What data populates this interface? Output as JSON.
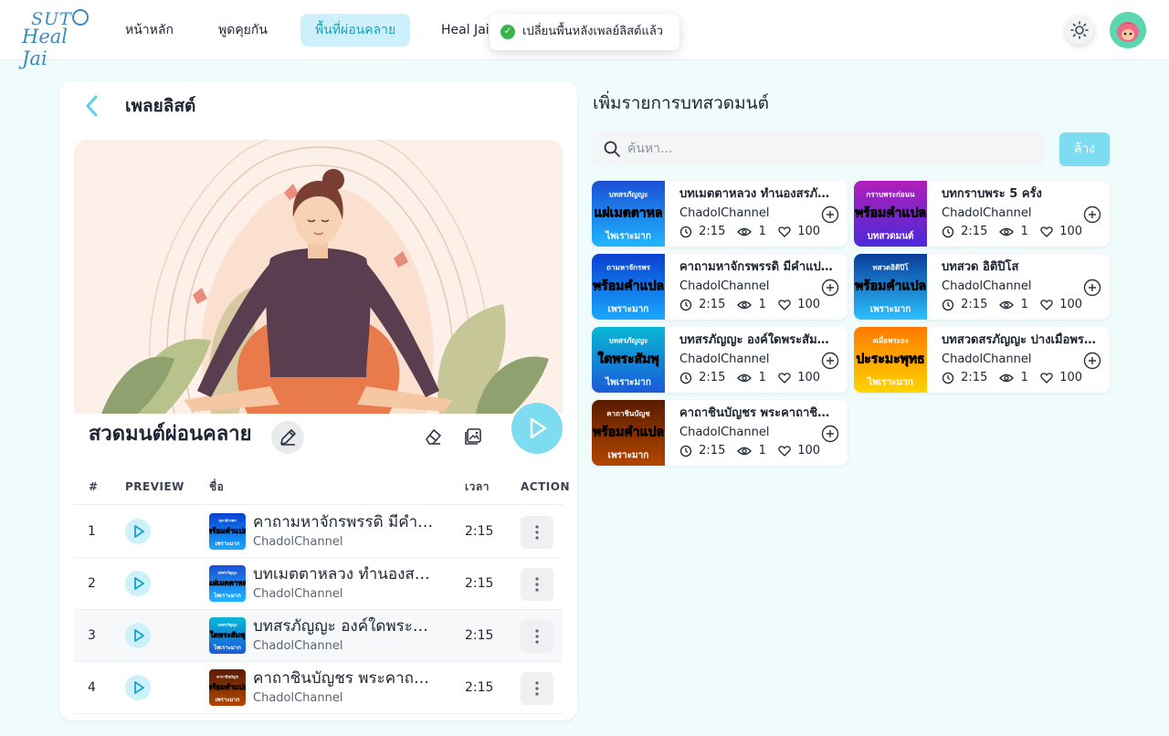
{
  "header": {
    "logo_line1": "SUT",
    "logo_line2": "Heal Jai",
    "nav": [
      {
        "label": "หน้าหลัก",
        "active": false
      },
      {
        "label": "พูดคุยกัน",
        "active": false
      },
      {
        "label": "พื้นที่ผ่อนคลาย",
        "active": true
      },
      {
        "label": "Heal Jai",
        "active": false
      }
    ],
    "toast": "เปลี่ยนพื้นหลังเพลย์ลิสต์แล้ว"
  },
  "playlist": {
    "title": "เพลยลิสต์",
    "name": "สวดมนต์ผ่อนคลาย",
    "table": {
      "headers": {
        "num": "#",
        "preview": "PREVIEW",
        "name": "ชื่อ",
        "time": "เวลา",
        "action": "ACTION"
      },
      "rows": [
        {
          "num": "1",
          "title": "คาถามหาจักรพรรดิ มีคำแปล...",
          "channel": "ChadolChannel",
          "duration": "2:15",
          "thumb_top": "มหาจักรพร",
          "thumb_mid": "(พร้อมคำแปล)",
          "thumb_bottom": "เพราะมาก"
        },
        {
          "num": "2",
          "title": "บทเมตตาหลวง ทำนองสรภัญญะ",
          "channel": "ChadolChannel",
          "duration": "2:15",
          "thumb_top": "บทสรภัญญะ",
          "thumb_mid": "แผ่เมตตาหล",
          "thumb_bottom": "ไพเราะมาก"
        },
        {
          "num": "3",
          "title": "บทสรภัญญะ องค์ใดพระสัมพุทธ",
          "channel": "ChadolChannel",
          "duration": "2:15",
          "thumb_top": "บทสรภัญญะ",
          "thumb_mid": "ใดพระสัมพุ",
          "thumb_bottom": "ไพเราะมาก"
        },
        {
          "num": "4",
          "title": "คาถาชินบัญชร พระคาถาชินบัญชร",
          "channel": "ChadolChannel",
          "duration": "2:15",
          "thumb_top": "คาถาชินบัญช",
          "thumb_mid": "(พร้อมคำแปล)",
          "thumb_bottom": "เพราะมาก"
        }
      ]
    }
  },
  "add_panel": {
    "title": "เพิ่มรายการบทสวดมนต์",
    "search_placeholder": "ค้นหา...",
    "clear_label": "ล้าง",
    "cards": [
      {
        "title": "บทเมตตาหลวง ทำนองสรภัญญะ",
        "channel": "ChadolChannel",
        "duration": "2:15",
        "views": "1",
        "likes": "100",
        "thumb_top": "บทสรภัญญะ",
        "thumb_mid": "แผ่เมตตาหล",
        "thumb_bottom": "ไพเราะมาก"
      },
      {
        "title": "บทกราบพระ 5 ครั้ง",
        "channel": "ChadolChannel",
        "duration": "2:15",
        "views": "1",
        "likes": "100",
        "thumb_top": "กราบพระก่อนน",
        "thumb_mid": "(พร้อมคำแปล)",
        "thumb_bottom": "บทสวดมนต์"
      },
      {
        "title": "คาถามหาจักรพรรดิ มีคำแปล...",
        "channel": "ChadolChannel",
        "duration": "2:15",
        "views": "1",
        "likes": "100",
        "thumb_top": "ถามหาจักรพร",
        "thumb_mid": "(พร้อมคำแปล)",
        "thumb_bottom": "เพราะมาก"
      },
      {
        "title": "บทสวด อิติปิโส",
        "channel": "ChadolChannel",
        "duration": "2:15",
        "views": "1",
        "likes": "100",
        "thumb_top": "ทสวดอิติปิโ",
        "thumb_mid": "(พร้อมคำแปล)",
        "thumb_bottom": "เพราะมาก"
      },
      {
        "title": "บทสรภัญญะ องค์ใดพระสัมพุทธ",
        "channel": "ChadolChannel",
        "duration": "2:15",
        "views": "1",
        "likes": "100",
        "thumb_top": "บทสรภัญญะ",
        "thumb_mid": "ใดพระสัมพุ",
        "thumb_bottom": "ไพเราะมาก"
      },
      {
        "title": "บทสวดสรภัญญะ ปางเมื่อพระองค์",
        "channel": "ChadolChannel",
        "duration": "2:15",
        "views": "1",
        "likes": "100",
        "thumb_top": "งเมื่อพระอง",
        "thumb_mid": "ปะระมะพุทธ",
        "thumb_bottom": "ไพเราะมาก"
      },
      {
        "title": "คาถาชินบัญชร พระคาถาชินบัญชร",
        "channel": "ChadolChannel",
        "duration": "2:15",
        "views": "1",
        "likes": "100",
        "thumb_top": "คาถาชินบัญช",
        "thumb_mid": "(พร้อมคำแปล)",
        "thumb_bottom": "เพราะมาก"
      }
    ]
  },
  "colors": {
    "accent": "#17a2c8",
    "accent_light": "#cdf1fa",
    "play": "#7ddcf2",
    "success": "#38b44a"
  }
}
